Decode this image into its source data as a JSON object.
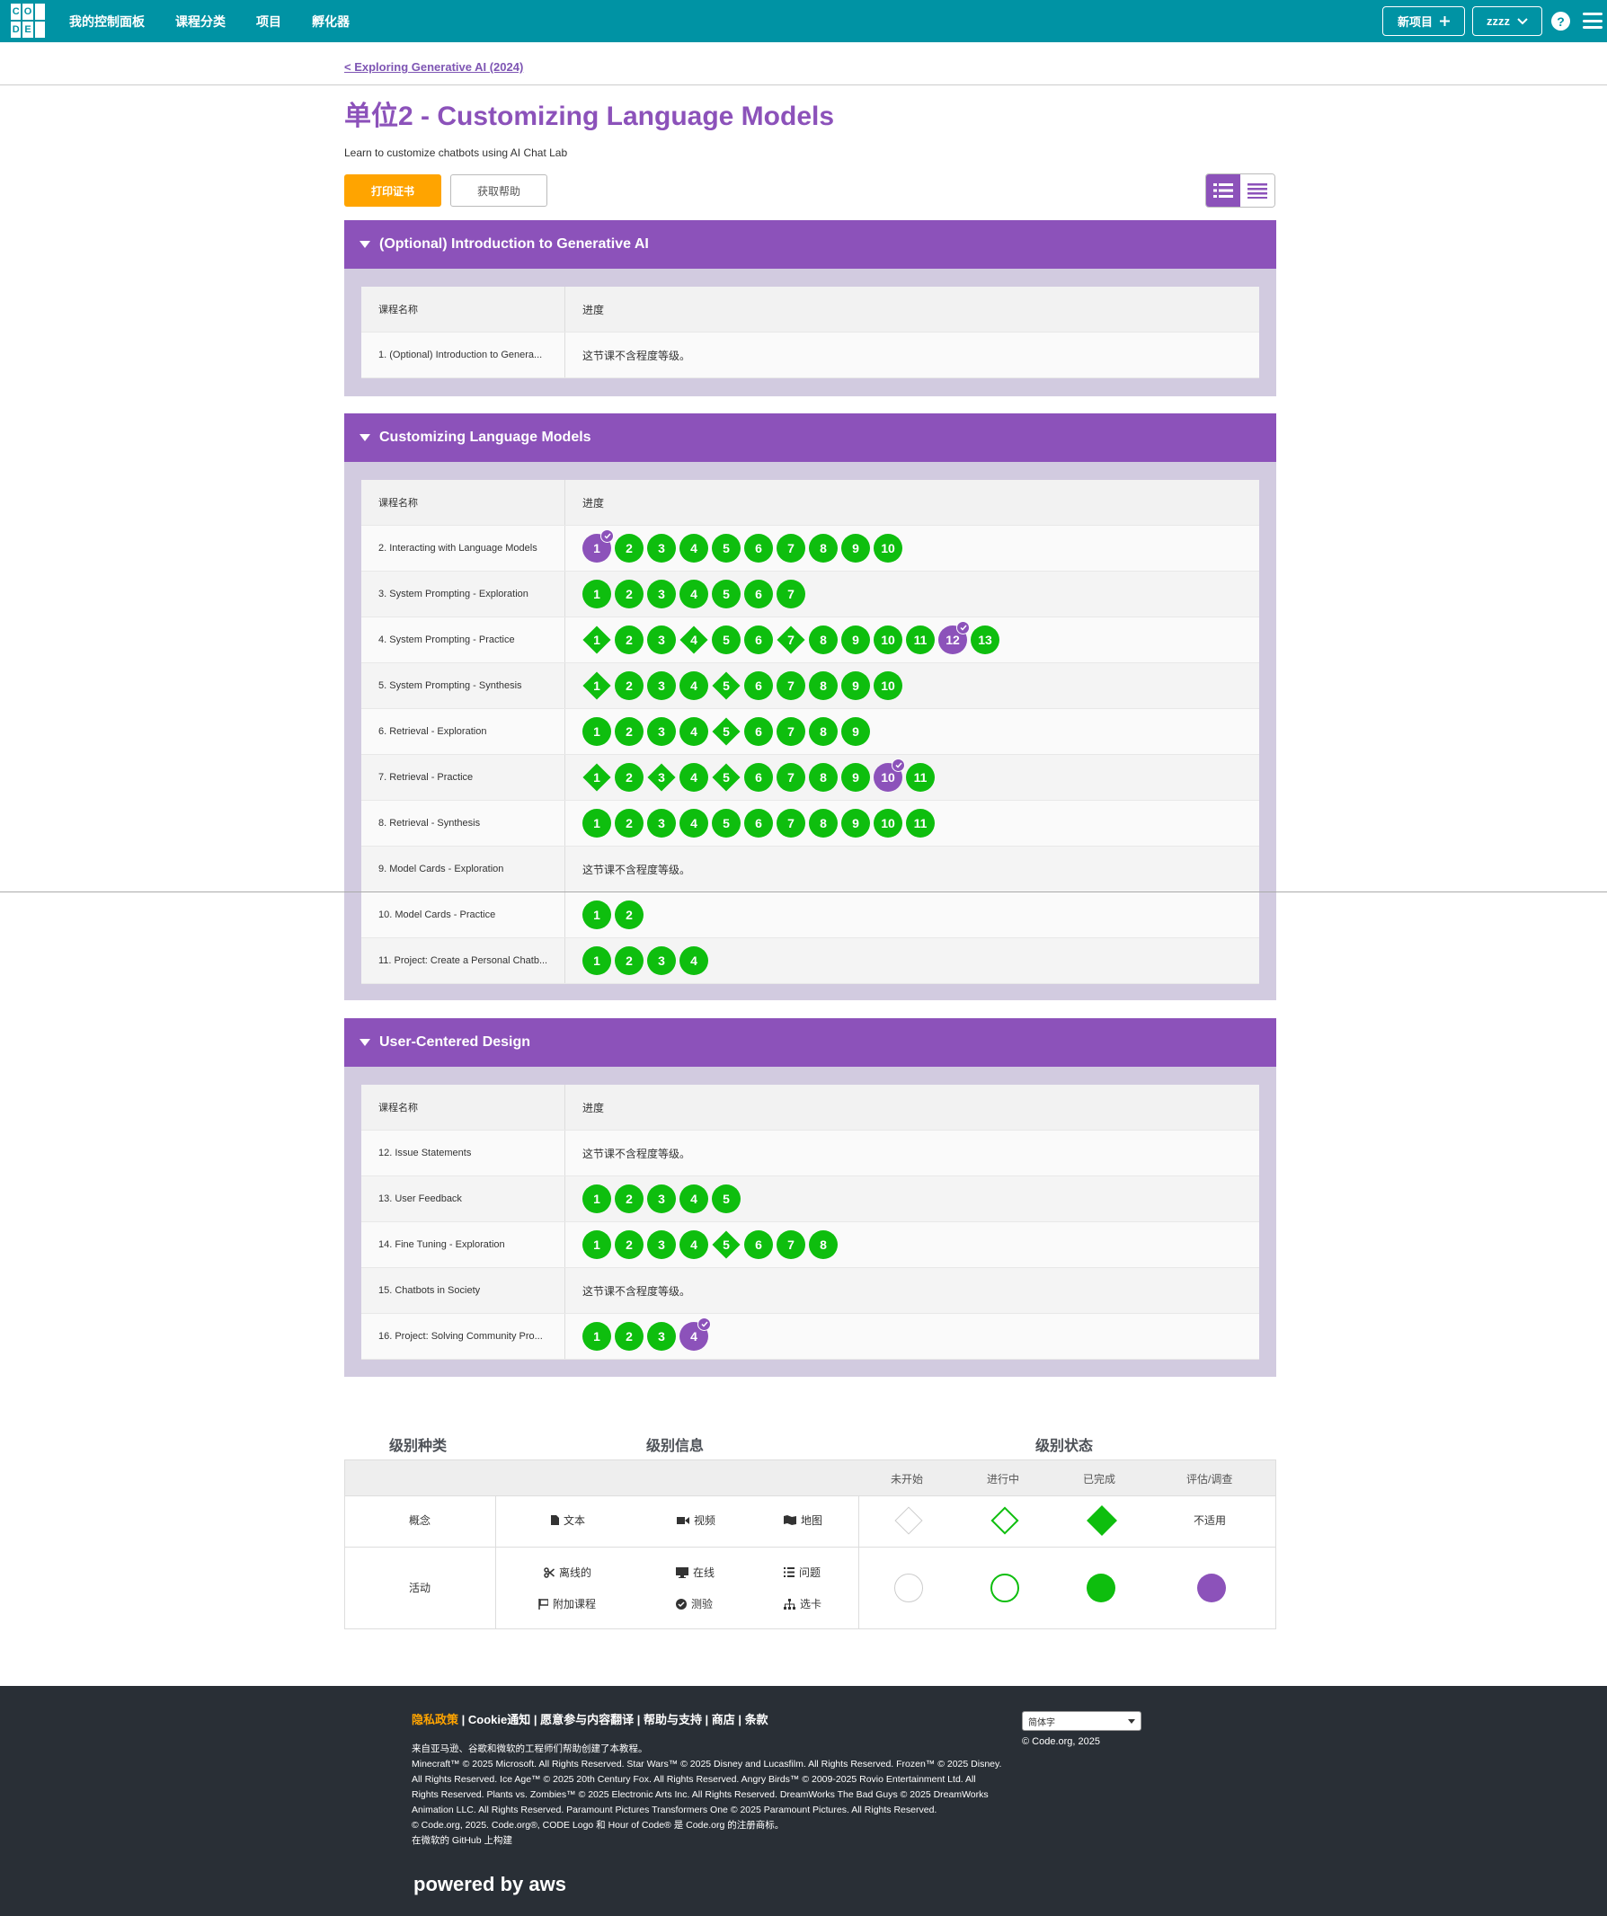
{
  "header": {
    "logo_letters": [
      "C",
      "O",
      "",
      "D",
      "E",
      ""
    ],
    "nav": [
      "我的控制面板",
      "课程分类",
      "项目",
      "孵化器"
    ],
    "new_project": "新项目",
    "user": "zzzz"
  },
  "breadcrumb": "< Exploring Generative AI (2024)",
  "title": "单位2 - Customizing Language Models",
  "subtitle": "Learn to customize chatbots using AI Chat Lab",
  "buttons": {
    "print": "打印证书",
    "help": "获取帮助"
  },
  "table_headers": {
    "name": "课程名称",
    "progress": "进度"
  },
  "no_levels_text": "这节课不含程度等级。",
  "sections": [
    {
      "title": "(Optional) Introduction to Generative AI",
      "lessons": [
        {
          "name": "1. (Optional) Introduction to Genera...",
          "levels": []
        }
      ]
    },
    {
      "title": "Customizing Language Models",
      "lessons": [
        {
          "name": "2. Interacting with Language Models",
          "levels": [
            {
              "n": "1",
              "shape": "circle",
              "status": "assessment"
            },
            {
              "n": "2",
              "shape": "circle"
            },
            {
              "n": "3",
              "shape": "circle"
            },
            {
              "n": "4",
              "shape": "circle"
            },
            {
              "n": "5",
              "shape": "circle"
            },
            {
              "n": "6",
              "shape": "circle"
            },
            {
              "n": "7",
              "shape": "circle"
            },
            {
              "n": "8",
              "shape": "circle"
            },
            {
              "n": "9",
              "shape": "circle"
            },
            {
              "n": "10",
              "shape": "circle"
            }
          ]
        },
        {
          "name": "3. System Prompting - Exploration",
          "levels": [
            {
              "n": "1",
              "shape": "circle"
            },
            {
              "n": "2",
              "shape": "circle"
            },
            {
              "n": "3",
              "shape": "circle"
            },
            {
              "n": "4",
              "shape": "circle"
            },
            {
              "n": "5",
              "shape": "circle"
            },
            {
              "n": "6",
              "shape": "circle"
            },
            {
              "n": "7",
              "shape": "circle"
            }
          ]
        },
        {
          "name": "4. System Prompting - Practice",
          "levels": [
            {
              "n": "1",
              "shape": "diamond"
            },
            {
              "n": "2",
              "shape": "circle"
            },
            {
              "n": "3",
              "shape": "circle"
            },
            {
              "n": "4",
              "shape": "diamond"
            },
            {
              "n": "5",
              "shape": "circle"
            },
            {
              "n": "6",
              "shape": "circle"
            },
            {
              "n": "7",
              "shape": "diamond"
            },
            {
              "n": "8",
              "shape": "circle"
            },
            {
              "n": "9",
              "shape": "circle"
            },
            {
              "n": "10",
              "shape": "circle"
            },
            {
              "n": "11",
              "shape": "circle"
            },
            {
              "n": "12",
              "shape": "circle",
              "status": "assessment"
            },
            {
              "n": "13",
              "shape": "circle"
            }
          ]
        },
        {
          "name": "5. System Prompting - Synthesis",
          "levels": [
            {
              "n": "1",
              "shape": "diamond"
            },
            {
              "n": "2",
              "shape": "circle"
            },
            {
              "n": "3",
              "shape": "circle"
            },
            {
              "n": "4",
              "shape": "circle"
            },
            {
              "n": "5",
              "shape": "diamond"
            },
            {
              "n": "6",
              "shape": "circle"
            },
            {
              "n": "7",
              "shape": "circle"
            },
            {
              "n": "8",
              "shape": "circle"
            },
            {
              "n": "9",
              "shape": "circle"
            },
            {
              "n": "10",
              "shape": "circle"
            }
          ]
        },
        {
          "name": "6. Retrieval - Exploration",
          "levels": [
            {
              "n": "1",
              "shape": "circle"
            },
            {
              "n": "2",
              "shape": "circle"
            },
            {
              "n": "3",
              "shape": "circle"
            },
            {
              "n": "4",
              "shape": "circle"
            },
            {
              "n": "5",
              "shape": "diamond"
            },
            {
              "n": "6",
              "shape": "circle"
            },
            {
              "n": "7",
              "shape": "circle"
            },
            {
              "n": "8",
              "shape": "circle"
            },
            {
              "n": "9",
              "shape": "circle"
            }
          ]
        },
        {
          "name": "7. Retrieval - Practice",
          "levels": [
            {
              "n": "1",
              "shape": "diamond"
            },
            {
              "n": "2",
              "shape": "circle"
            },
            {
              "n": "3",
              "shape": "diamond"
            },
            {
              "n": "4",
              "shape": "circle"
            },
            {
              "n": "5",
              "shape": "diamond"
            },
            {
              "n": "6",
              "shape": "circle"
            },
            {
              "n": "7",
              "shape": "circle"
            },
            {
              "n": "8",
              "shape": "circle"
            },
            {
              "n": "9",
              "shape": "circle"
            },
            {
              "n": "10",
              "shape": "circle",
              "status": "assessment"
            },
            {
              "n": "11",
              "shape": "circle"
            }
          ]
        },
        {
          "name": "8. Retrieval - Synthesis",
          "levels": [
            {
              "n": "1",
              "shape": "circle"
            },
            {
              "n": "2",
              "shape": "circle"
            },
            {
              "n": "3",
              "shape": "circle"
            },
            {
              "n": "4",
              "shape": "circle"
            },
            {
              "n": "5",
              "shape": "circle"
            },
            {
              "n": "6",
              "shape": "circle"
            },
            {
              "n": "7",
              "shape": "circle"
            },
            {
              "n": "8",
              "shape": "circle"
            },
            {
              "n": "9",
              "shape": "circle"
            },
            {
              "n": "10",
              "shape": "circle"
            },
            {
              "n": "11",
              "shape": "circle"
            }
          ]
        },
        {
          "name": "9. Model Cards - Exploration",
          "levels": []
        },
        {
          "name": "10. Model Cards - Practice",
          "levels": [
            {
              "n": "1",
              "shape": "circle"
            },
            {
              "n": "2",
              "shape": "circle"
            }
          ]
        },
        {
          "name": "11. Project: Create a Personal Chatb...",
          "levels": [
            {
              "n": "1",
              "shape": "circle"
            },
            {
              "n": "2",
              "shape": "circle"
            },
            {
              "n": "3",
              "shape": "circle"
            },
            {
              "n": "4",
              "shape": "circle"
            }
          ]
        }
      ]
    },
    {
      "title": "User-Centered Design",
      "lessons": [
        {
          "name": "12. Issue Statements",
          "levels": []
        },
        {
          "name": "13. User Feedback",
          "levels": [
            {
              "n": "1",
              "shape": "circle"
            },
            {
              "n": "2",
              "shape": "circle"
            },
            {
              "n": "3",
              "shape": "circle"
            },
            {
              "n": "4",
              "shape": "circle"
            },
            {
              "n": "5",
              "shape": "circle"
            }
          ]
        },
        {
          "name": "14. Fine Tuning - Exploration",
          "levels": [
            {
              "n": "1",
              "shape": "circle"
            },
            {
              "n": "2",
              "shape": "circle"
            },
            {
              "n": "3",
              "shape": "circle"
            },
            {
              "n": "4",
              "shape": "circle"
            },
            {
              "n": "5",
              "shape": "diamond"
            },
            {
              "n": "6",
              "shape": "circle"
            },
            {
              "n": "7",
              "shape": "circle"
            },
            {
              "n": "8",
              "shape": "circle"
            }
          ]
        },
        {
          "name": "15. Chatbots in Society",
          "levels": []
        },
        {
          "name": "16. Project: Solving Community Pro...",
          "levels": [
            {
              "n": "1",
              "shape": "circle"
            },
            {
              "n": "2",
              "shape": "circle"
            },
            {
              "n": "3",
              "shape": "circle"
            },
            {
              "n": "4",
              "shape": "circle",
              "status": "assessment"
            }
          ]
        }
      ]
    }
  ],
  "legend": {
    "h_type": "级别种类",
    "h_info": "级别信息",
    "h_status": "级别状态",
    "status_cols": [
      "未开始",
      "进行中",
      "已完成",
      "评估/调查"
    ],
    "concept": "概念",
    "activity": "活动",
    "concept_items": [
      "文本",
      "视频",
      "地图"
    ],
    "activity_items": [
      "离线的",
      "在线",
      "问题",
      "附加课程",
      "测验",
      "选卡"
    ],
    "not_applicable": "不适用"
  },
  "footer": {
    "privacy": "隐私政策",
    "links_rest": " | Cookie通知 | 愿意参与内容翻译 | 帮助与支持 | 商店 | 条款",
    "line1": "来自亚马逊、谷歌和微软的工程师们帮助创建了本教程。",
    "line2": "Minecraft™ © 2025 Microsoft. All Rights Reserved. Star Wars™ © 2025 Disney and Lucasfilm. All Rights Reserved. Frozen™ © 2025 Disney. All Rights Reserved. Ice Age™ © 2025 20th Century Fox. All Rights Reserved. Angry Birds™ © 2009-2025 Rovio Entertainment Ltd. All Rights Reserved. Plants vs. Zombies™ © 2025 Electronic Arts Inc. All Rights Reserved. DreamWorks The Bad Guys © 2025 DreamWorks Animation LLC. All Rights Reserved. Paramount Pictures Transformers One © 2025 Paramount Pictures. All Rights Reserved.",
    "line3": "© Code.org, 2025. Code.org®, CODE Logo 和 Hour of Code® 是 Code.org 的注册商标。",
    "line4": "在微软的 GitHub 上构建",
    "language": "简体字",
    "copyright": "© Code.org, 2025",
    "powered": "powered by aws"
  }
}
